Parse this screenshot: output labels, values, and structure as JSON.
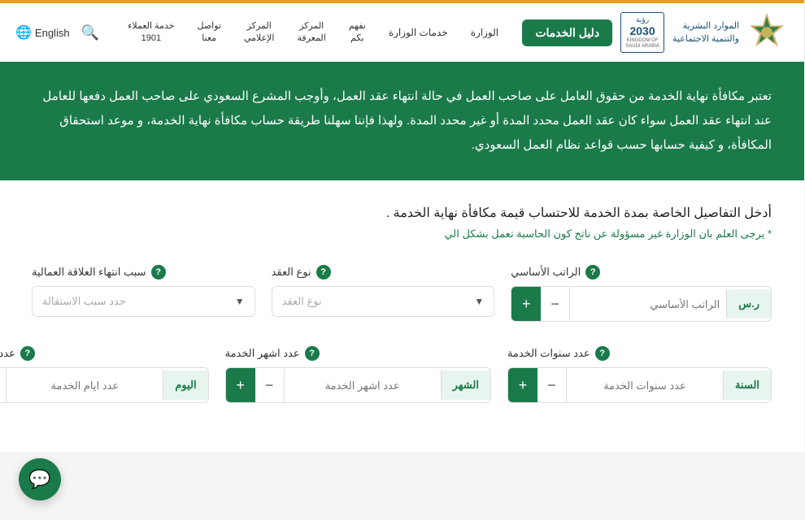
{
  "topBar": {},
  "header": {
    "ministryName1": "الموارد البشرية",
    "ministryName2": "والتنمية الاجتماعية",
    "visionYear": "رؤية",
    "visionNumber": "2030",
    "visionKingdom": "KINGDOM OF SAUDI ARABIA",
    "servicesBtn": "دليل الخدمات",
    "nav": [
      {
        "id": "ministry",
        "label": "الوزارة"
      },
      {
        "id": "services",
        "label": "خدمات الوزارة"
      },
      {
        "id": "understand-you",
        "label": "نفهم\nبكم"
      },
      {
        "id": "knowledge-center",
        "label": "المركز\nالمعرفة"
      },
      {
        "id": "media-center",
        "label": "المركز\nالإعلامي"
      },
      {
        "id": "contact-us",
        "label": "تواصل\nمعنا"
      },
      {
        "id": "customer-service",
        "label": "خدمة العملاء\n1901"
      }
    ],
    "searchPlaceholder": "بحث",
    "language": "English",
    "globeIcon": "🌐"
  },
  "hero": {
    "text": "تعتبر مكافأة نهاية الخدمة من حقوق العامل على صاحب العمل في حالة انتهاء عقد العمل، وأوجب المشرع السعودي على صاحب العمل دفعها للعامل عند انتهاء عقد العمل سواء كان عقد العمل محدد المدة أو غير محدد المدة. ولهذا فإننا سهلنا طريقة حساب مكافأة نهاية الخدمة، و موعد استحقاق المكافأة، و كيفية حسابها حسب قواعد نظام العمل السعودي."
  },
  "form": {
    "sectionTitle": "أدخل التفاصيل الخاصة بمدة الخدمة للاحتساب قيمة مكافأة نهاية الخدمة .",
    "sectionNote": "* يرجى العلم بان الوزارة غير مسؤولة عن ناتج كون الحاسبة تعمل بشكل الي",
    "fields": {
      "basicSalary": {
        "label": "الراتب الأساسي",
        "placeholder": "الراتب الأساسي",
        "currency": "ر.س"
      },
      "contractType": {
        "label": "نوع العقد",
        "placeholder": "نوع العقد"
      },
      "terminationReason": {
        "label": "سبب انتهاء العلاقة العمالية",
        "placeholder": "حدد سبب الاستقالة"
      },
      "serviceYears": {
        "label": "عدد سنوات الخدمة",
        "placeholder": "عدد سنوات الخدمة",
        "unit": "السنة"
      },
      "serviceMonths": {
        "label": "عدد اشهر الخدمة",
        "placeholder": "عدد اشهر الخدمة",
        "unit": "الشهر"
      },
      "serviceDays": {
        "label": "عدد ايام الخدمة",
        "placeholder": "عدد ايام الخدمة",
        "unit": "اليوم"
      }
    }
  },
  "chat": {
    "icon": "💬"
  }
}
